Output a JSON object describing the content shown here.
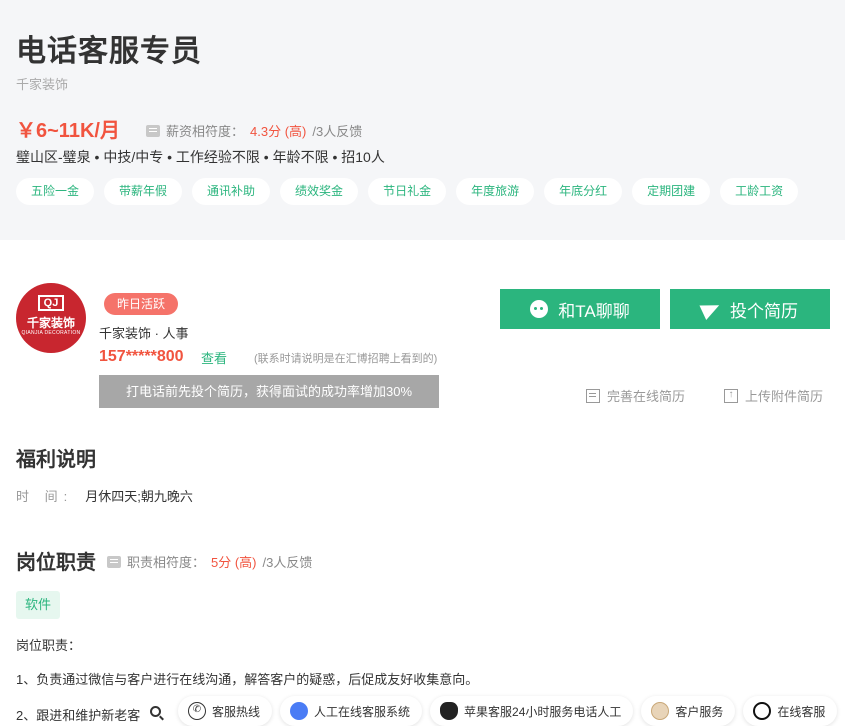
{
  "job": {
    "title": "电话客服专员",
    "company": "千家装饰",
    "salary": "￥6~11K/月",
    "salary_match_label": "薪资相符度：",
    "salary_match_score": "4.3分 (高)",
    "salary_match_feedback": "/3人反馈",
    "info": "璧山区-璧泉 • 中技/中专 • 工作经验不限  • 年龄不限 • 招10人",
    "tags": [
      "五险一金",
      "带薪年假",
      "通讯补助",
      "绩效奖金",
      "节日礼金",
      "年度旅游",
      "年底分红",
      "定期团建",
      "工龄工资"
    ]
  },
  "company_logo": {
    "mark": "QJ",
    "name": "千家装饰",
    "en": "QIANJIA DECORATION"
  },
  "contact": {
    "active_badge": "昨日活跃",
    "name": "千家装饰 · 人事",
    "phone": "157*****800",
    "view_link": "查看",
    "phone_note": "(联系时请说明是在汇博招聘上看到的)",
    "tooltip": "打电话前先投个简历，获得面试的成功率增加30%"
  },
  "actions": {
    "chat_label": "和TA聊聊",
    "resume_label": "投个简历",
    "improve_resume": "完善在线简历",
    "upload_resume": "上传附件简历"
  },
  "welfare": {
    "heading": "福利说明",
    "time_label": "时 间:",
    "time_value": "月休四天;朝九晚六"
  },
  "duty": {
    "heading": "岗位职责",
    "match_label": "职责相符度：",
    "match_score": "5分 (高)",
    "match_feedback": "/3人反馈",
    "skill_tag": "软件",
    "lines": [
      "岗位职责：",
      "1、负责通过微信与客户进行在线沟通，解答客户的疑惑，后促成友好收集意向。",
      "2、跟进和维护新老客"
    ]
  },
  "quick_bar": {
    "items": [
      "客服热线",
      "人工在线客服系统",
      "苹果客服24小时服务电话人工",
      "客户服务",
      "在线客服"
    ]
  },
  "colors": {
    "accent_green": "#2bb57e",
    "salary_red": "#f1543f",
    "badge_red": "#f5736a",
    "header_bg": "#f5f6f8"
  }
}
